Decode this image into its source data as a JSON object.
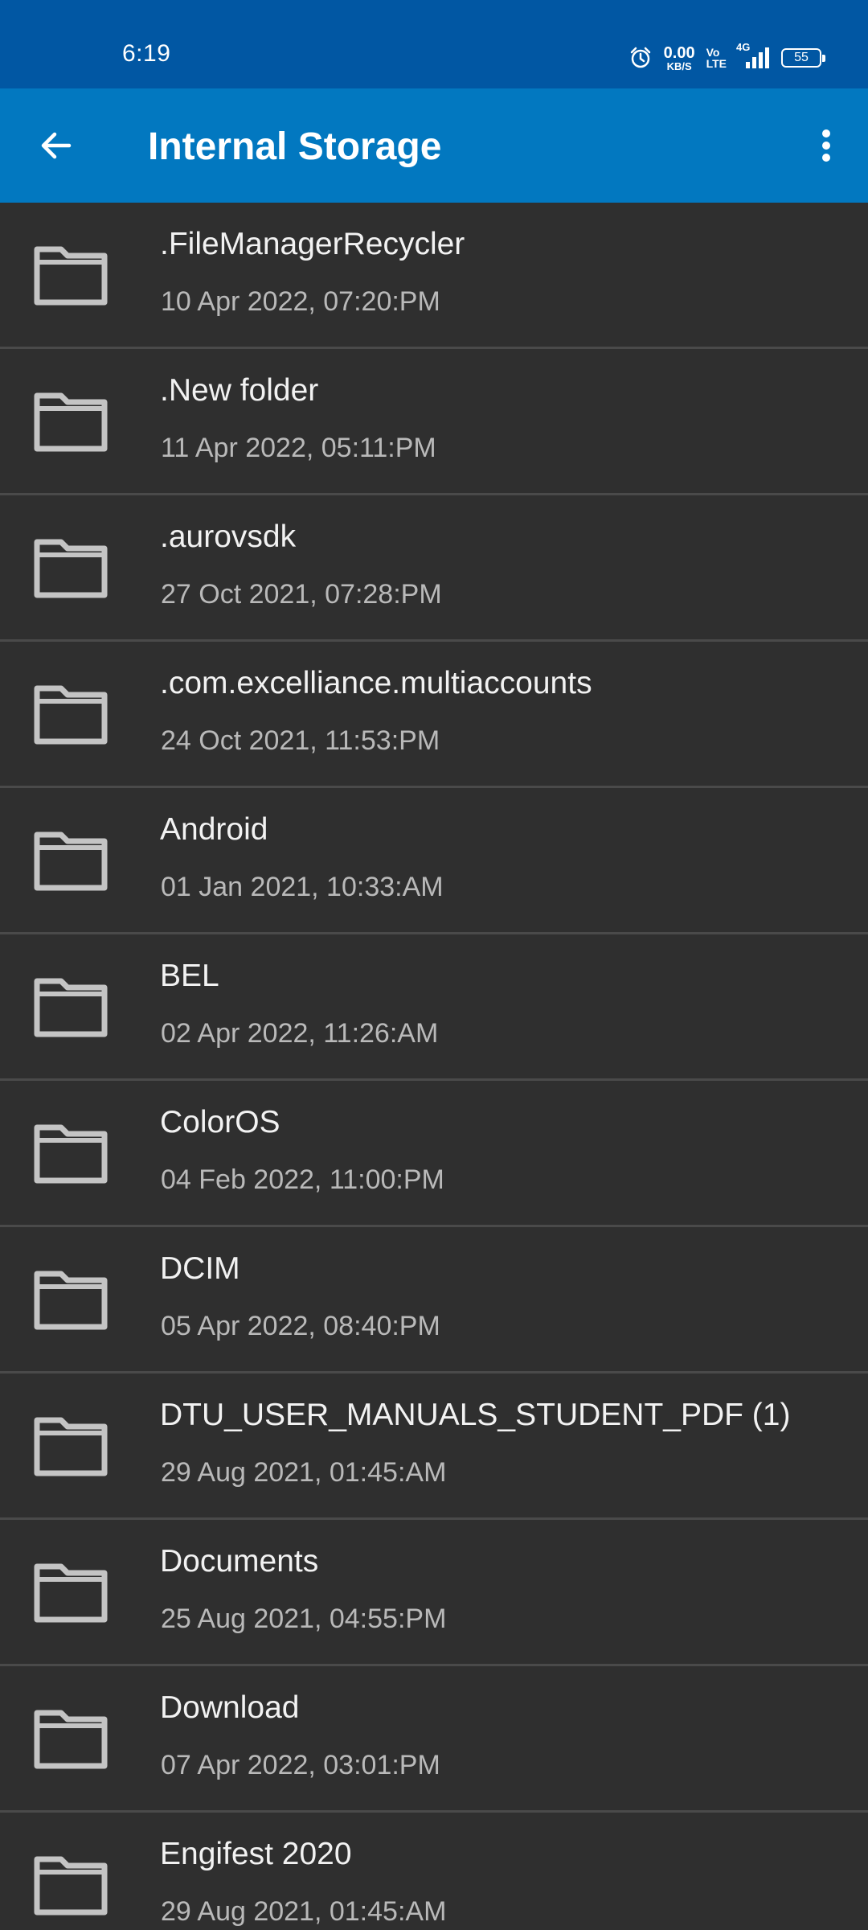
{
  "status_bar": {
    "time": "6:19",
    "net_speed_value": "0.00",
    "net_speed_unit": "KB/S",
    "volte_top": "Vo",
    "volte_bottom": "LTE",
    "network_type": "4G",
    "battery_level": "55",
    "icons": [
      "alarm-icon",
      "signal-icon",
      "battery-icon"
    ]
  },
  "app_bar": {
    "title": "Internal Storage",
    "back_icon": "arrow-left-icon",
    "menu_icon": "more-vertical-icon"
  },
  "files": [
    {
      "name": ".FileManagerRecycler",
      "date": "10 Apr 2022, 07:20:PM"
    },
    {
      "name": ".New folder",
      "date": "11 Apr 2022, 05:11:PM"
    },
    {
      "name": ".aurovsdk",
      "date": "27 Oct 2021, 07:28:PM"
    },
    {
      "name": ".com.excelliance.multiaccounts",
      "date": "24 Oct 2021, 11:53:PM"
    },
    {
      "name": "Android",
      "date": "01 Jan 2021, 10:33:AM"
    },
    {
      "name": "BEL",
      "date": "02 Apr 2022, 11:26:AM"
    },
    {
      "name": "ColorOS",
      "date": "04 Feb 2022, 11:00:PM"
    },
    {
      "name": "DCIM",
      "date": "05 Apr 2022, 08:40:PM"
    },
    {
      "name": "DTU_USER_MANUALS_STUDENT_PDF (1)",
      "date": "29 Aug 2021, 01:45:AM"
    },
    {
      "name": "Documents",
      "date": "25 Aug 2021, 04:55:PM"
    },
    {
      "name": "Download",
      "date": "07 Apr 2022, 03:01:PM"
    },
    {
      "name": "Engifest 2020",
      "date": "29 Aug 2021, 01:45:AM"
    }
  ],
  "colors": {
    "status_bar_bg": "#0157a3",
    "app_bar_bg": "#0278c0",
    "list_bg": "#2f2f2f",
    "divider": "#4a4a4a",
    "folder_icon": "#c4c4c4"
  }
}
